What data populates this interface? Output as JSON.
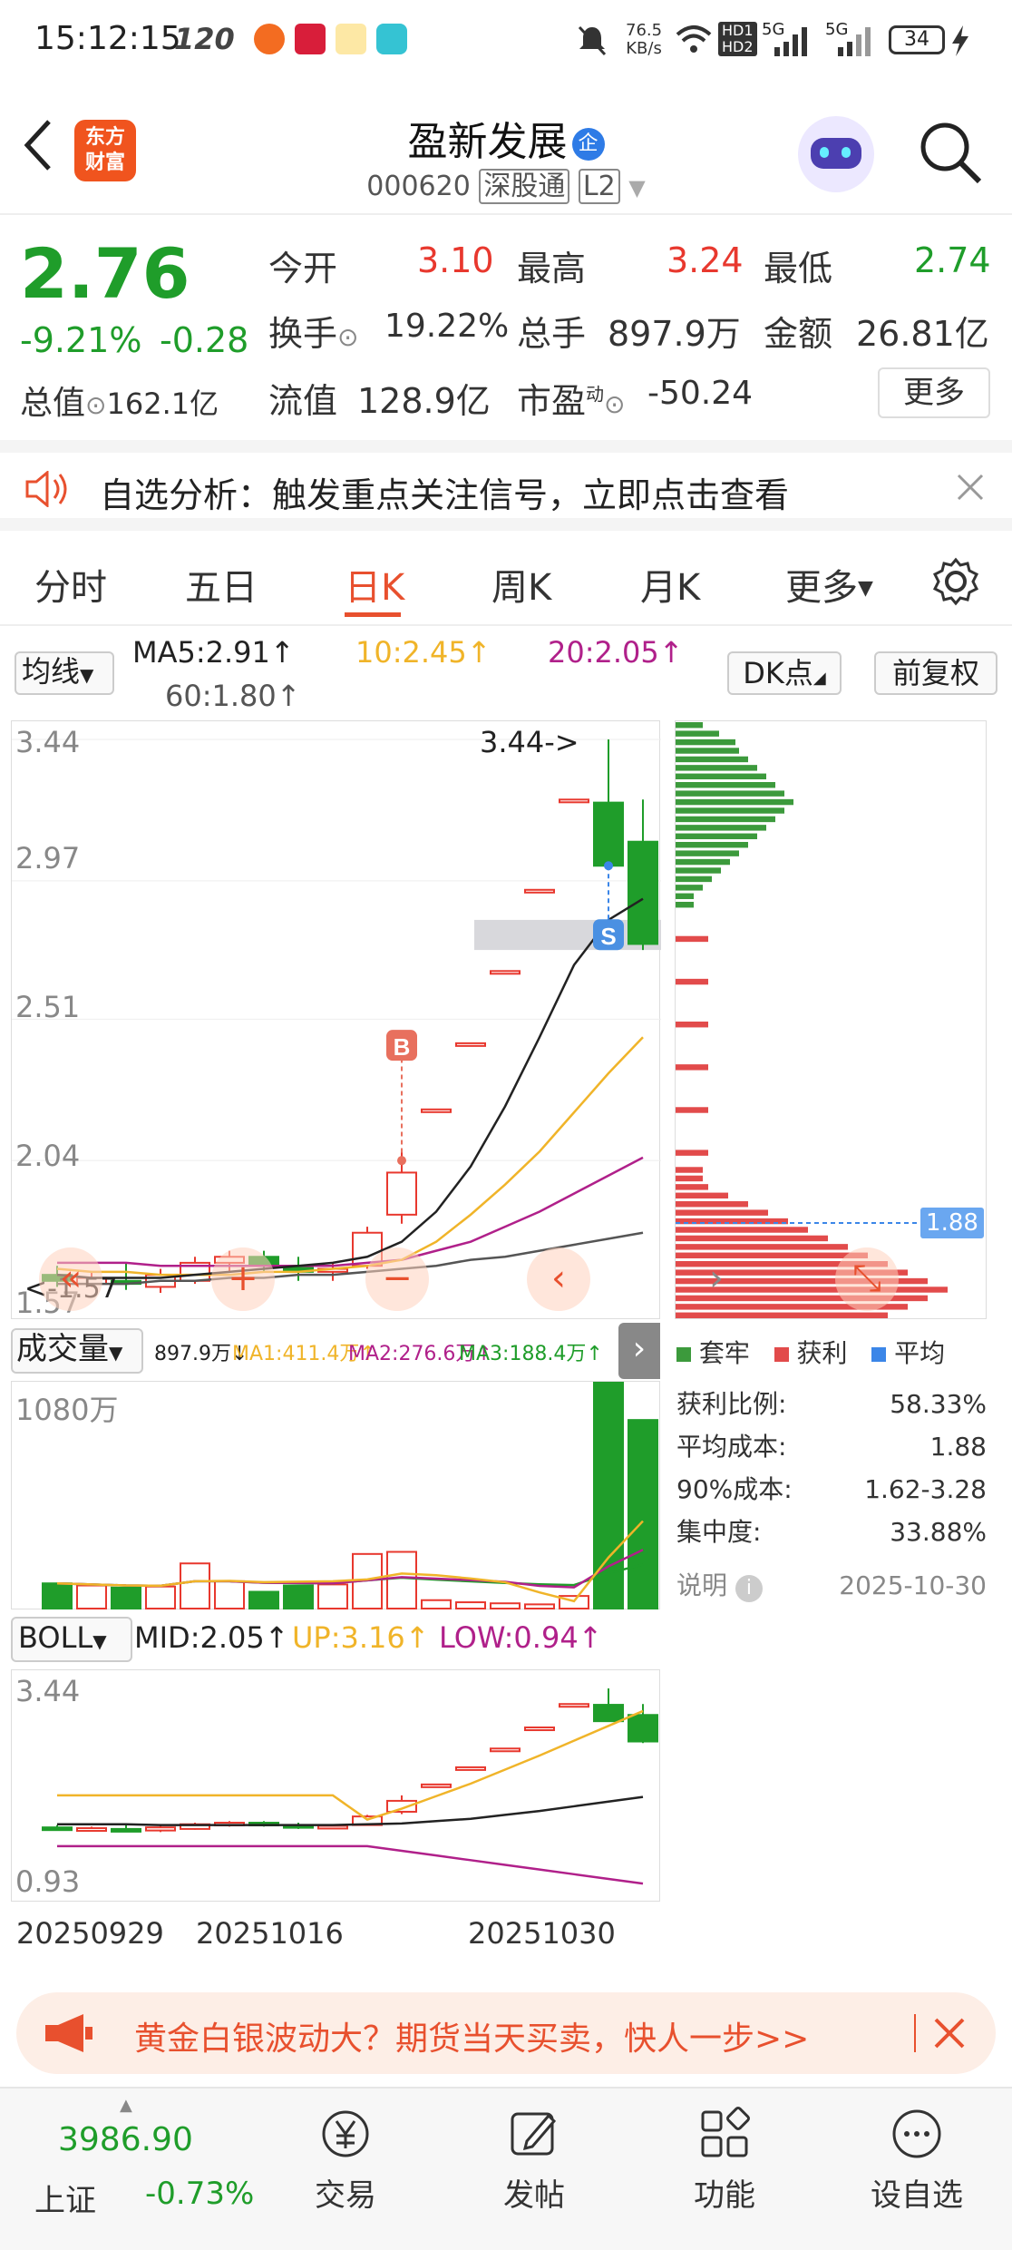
{
  "status": {
    "time": "15:12:15",
    "hz": "120",
    "net_speed": "76.5",
    "net_unit": "KB/s",
    "hd1": "HD1",
    "hd2": "HD2",
    "sig1": "5G",
    "sig2": "5G",
    "battery": "34"
  },
  "header": {
    "logo_line1": "东方",
    "logo_line2": "财富",
    "title": "盈新发展",
    "badge": "企",
    "code": "000620",
    "market": "深股通",
    "level": "L2"
  },
  "quote": {
    "price": "2.76",
    "change_pct": "-9.21%",
    "change": "-0.28",
    "open_label": "今开",
    "open": "3.10",
    "high_label": "最高",
    "high": "3.24",
    "low_label": "最低",
    "low": "2.74",
    "turnover_label": "换手",
    "turnover": "19.22%",
    "volume_label": "总手",
    "volume": "897.9万",
    "amount_label": "金额",
    "amount": "26.81亿",
    "mktcap_label": "总值",
    "mktcap": "162.1亿",
    "float_label": "流值",
    "float": "128.9亿",
    "pe_label": "市盈",
    "pe_sup": "动",
    "pe": "-50.24",
    "more": "更多"
  },
  "alert": {
    "text": "自选分析：触发重点关注信号，立即点击查看"
  },
  "tabs": [
    "分时",
    "五日",
    "日K",
    "周K",
    "月K",
    "更多"
  ],
  "ma": {
    "select": "均线",
    "ma5": "MA5:2.91",
    "ma10": "10:2.45",
    "ma20": "20:2.05",
    "ma60": "60:1.80",
    "dk": "DK点",
    "adjust": "前复权",
    "arrow": "↑"
  },
  "colors": {
    "up": "#e8382e",
    "down": "#1f9d2a",
    "ma5": "#222222",
    "ma10": "#f0b429",
    "ma20": "#b0208a",
    "ma60": "#555555",
    "accent": "#e8502e"
  },
  "chart_data": [
    {
      "type": "candlestick",
      "ylim": [
        1.57,
        3.44
      ],
      "y_ticks": [
        "3.44",
        "2.97",
        "2.51",
        "2.04",
        "1.57"
      ],
      "high_marker": "3.44->",
      "low_marker": "1.57",
      "buy_mark": "B",
      "sell_mark": "S",
      "candles": [
        [
          1.66,
          1.69,
          1.62,
          1.64
        ],
        [
          1.63,
          1.67,
          1.62,
          1.65
        ],
        [
          1.64,
          1.7,
          1.61,
          1.63
        ],
        [
          1.62,
          1.68,
          1.6,
          1.66
        ],
        [
          1.64,
          1.72,
          1.63,
          1.7
        ],
        [
          1.7,
          1.74,
          1.67,
          1.72
        ],
        [
          1.72,
          1.74,
          1.67,
          1.69
        ],
        [
          1.69,
          1.72,
          1.64,
          1.67
        ],
        [
          1.67,
          1.7,
          1.64,
          1.68
        ],
        [
          1.69,
          1.82,
          1.68,
          1.8
        ],
        [
          1.86,
          2.07,
          1.83,
          2.0
        ],
        [
          2.21,
          2.21,
          2.2,
          2.21
        ],
        [
          2.43,
          2.43,
          2.43,
          2.43
        ],
        [
          2.67,
          2.67,
          2.67,
          2.67
        ],
        [
          2.94,
          2.94,
          2.94,
          2.94
        ],
        [
          3.24,
          3.24,
          3.24,
          3.24
        ],
        [
          3.23,
          3.44,
          3.02,
          3.02
        ],
        [
          3.1,
          3.24,
          2.74,
          2.76
        ]
      ],
      "ma5": [
        1.66,
        1.65,
        1.65,
        1.65,
        1.66,
        1.67,
        1.68,
        1.69,
        1.7,
        1.72,
        1.77,
        1.87,
        2.02,
        2.22,
        2.45,
        2.69,
        2.84,
        2.91
      ],
      "ma10": [
        1.68,
        1.67,
        1.67,
        1.66,
        1.66,
        1.66,
        1.67,
        1.67,
        1.68,
        1.69,
        1.71,
        1.77,
        1.86,
        1.96,
        2.07,
        2.2,
        2.33,
        2.45
      ],
      "ma20": [
        1.7,
        1.7,
        1.7,
        1.69,
        1.69,
        1.69,
        1.69,
        1.69,
        1.69,
        1.7,
        1.71,
        1.74,
        1.77,
        1.82,
        1.87,
        1.93,
        1.99,
        2.05
      ],
      "ma60": [
        1.63,
        1.63,
        1.63,
        1.64,
        1.64,
        1.65,
        1.65,
        1.66,
        1.66,
        1.67,
        1.68,
        1.69,
        1.71,
        1.72,
        1.74,
        1.76,
        1.78,
        1.8
      ]
    },
    {
      "type": "bar",
      "title": "成交量",
      "summary": "897.9万",
      "ma1": "MA1:411.4万",
      "ma2": "MA2:276.6万",
      "ma3": "MA3:188.4万",
      "y_max_label": "1080万",
      "values": [
        120,
        110,
        100,
        105,
        215,
        130,
        80,
        110,
        115,
        260,
        270,
        40,
        30,
        25,
        20,
        60,
        1080,
        897.9
      ]
    },
    {
      "type": "line",
      "title": "BOLL",
      "mid": "MID:2.05",
      "up": "UP:3.16",
      "low": "LOW:0.94",
      "y_ticks": [
        "3.44",
        "0.93"
      ],
      "ylim": [
        0.93,
        3.44
      ],
      "x_ticks": [
        "20250929",
        "20251016",
        "20251030"
      ]
    },
    {
      "type": "bar",
      "title": "筹码分布",
      "avg_marker": "1.88",
      "legend": [
        "套牢",
        "获利",
        "平均"
      ]
    }
  ],
  "vol_select": "成交量",
  "chips": {
    "profit_ratio_label": "获利比例:",
    "profit_ratio": "58.33%",
    "avg_cost_label": "平均成本:",
    "avg_cost": "1.88",
    "cost90_label": "90%成本:",
    "cost90": "1.62-3.28",
    "concentration_label": "集中度:",
    "concentration": "33.88%",
    "note_label": "说明",
    "date": "2025-10-30"
  },
  "ad": {
    "text": "黄金白银波动大？期货当天买卖，快人一步>>"
  },
  "bottom": {
    "index_value": "3986.90",
    "index_name": "上证",
    "index_change": "-0.73%",
    "trade": "交易",
    "post": "发帖",
    "func": "功能",
    "watch": "设自选"
  }
}
